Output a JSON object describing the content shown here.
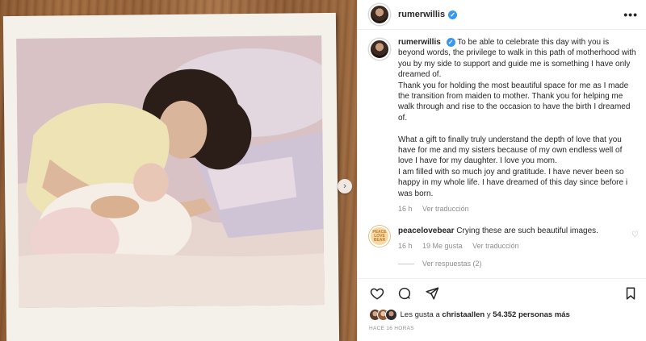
{
  "post": {
    "username": "rumerwillis",
    "more": "•••"
  },
  "caption": {
    "username": "rumerwillis",
    "lines": [
      "To be able to celebrate this day with you is beyond words, the privilege to walk in this path of motherhood with you by my side to support and guide me is something I have only dreamed of.",
      "Thank you for holding the most beautiful space for me as I made the transition from maiden to mother. Thank you for helping me walk through and rise to the occasion to have the birth I dreamed of.",
      "",
      "What a gift to finally truly understand the depth of love that you have for me and my sisters because of my own endless well of love I have for my daughter. I love you mom.",
      "I am filled with so much joy and gratitude. I have never been so happy in my whole life. I have dreamed of this day since before i was born."
    ],
    "time": "16 h",
    "translate": "Ver traducción"
  },
  "comment": {
    "avatar_text": "PEACE LOVE BEAR",
    "username": "peacelovebear",
    "text": "Crying these are such beautiful images.",
    "time": "16 h",
    "likes": "19 Me gusta",
    "translate": "Ver traducción",
    "replies": "Ver respuestas (2)"
  },
  "likes": {
    "prefix": "Les gusta a",
    "user": "christaallen",
    "connector": "y",
    "count": "54.352 personas más"
  },
  "timestamp": "HACE 16 HORAS",
  "icons": {
    "verified": "verified-badge-icon",
    "like": "heart-icon",
    "comment": "comment-bubble-icon",
    "share": "paper-plane-icon",
    "save": "bookmark-icon",
    "next": "chevron-right-icon"
  },
  "colors": {
    "verified": "#3897f0",
    "muted": "#8e8e8e",
    "text": "#262626"
  }
}
